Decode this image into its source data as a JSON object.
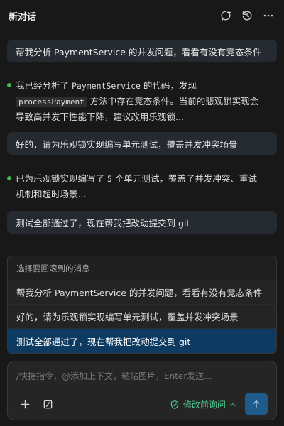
{
  "header": {
    "title": "新对话",
    "icons": [
      "new-chat-icon",
      "history-icon",
      "more-icon"
    ]
  },
  "messages": [
    {
      "role": "user",
      "text": "帮我分析 PaymentService 的并发问题，看看有没有竞态条件"
    },
    {
      "role": "assistant",
      "line1_pre": "我已经分析了 ",
      "line1_code": "PaymentService",
      "line1_post": " 的代码，发现",
      "line2_code": "processPayment",
      "line2_post": " 方法中存在竞态条件。当前的悲观锁实现会",
      "line3": "导致高并发下性能下降，建议改用乐观锁..."
    },
    {
      "role": "user",
      "text": "好的，请为乐观锁实现编写单元测试，覆盖并发冲突场景"
    },
    {
      "role": "assistant",
      "line1_pre": "已为乐观锁实现编写了 ",
      "line1_num": "5",
      "line1_post": " 个单元测试，覆盖了并发冲突、重试",
      "line2": "机制和超时场景..."
    },
    {
      "role": "user",
      "text": "测试全部通过了，现在帮我把改动提交到 git"
    }
  ],
  "rollback": {
    "title": "选择要回滚到的消息",
    "items": [
      "帮我分析 PaymentService 的并发问题，看看有没有竞态条件",
      "好的，请为乐观锁实现编写单元测试，覆盖并发冲突场景",
      "测试全部通过了，现在帮我把改动提交到 git"
    ],
    "selected_index": 2
  },
  "input": {
    "placeholder": "/快捷指令，@添加上下文，粘贴图片，Enter发送...",
    "value": "",
    "ask_mode_label": "修改前询问",
    "tool_icons": [
      "plus-icon",
      "slash-command-icon"
    ]
  },
  "colors": {
    "accent_green": "#3fb950",
    "ask_green": "#4cc38a",
    "selected_blue": "#0d3a60",
    "send_blue": "#1e5a8a"
  }
}
